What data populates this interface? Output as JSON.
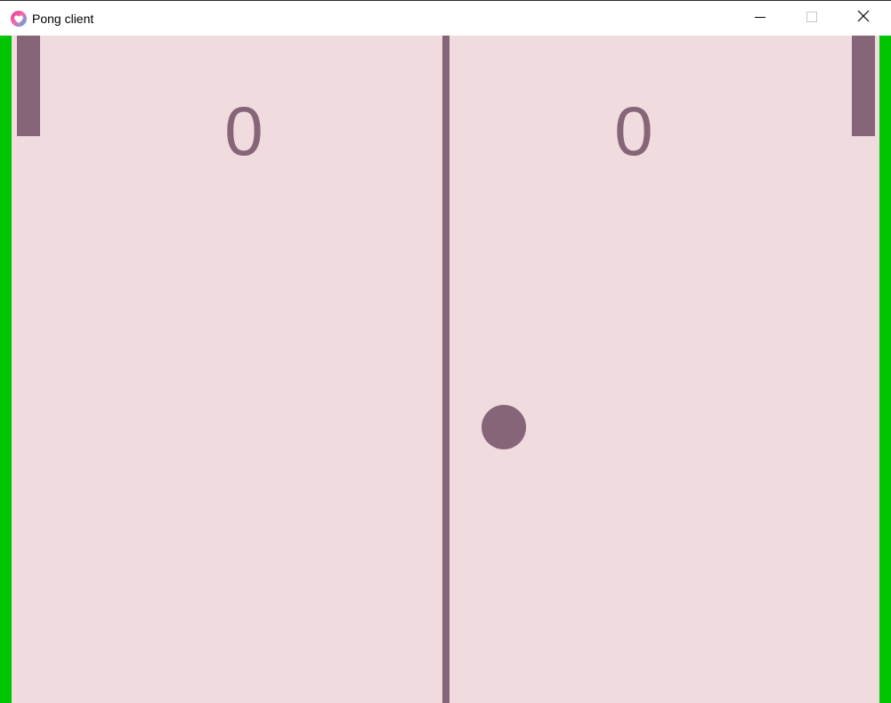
{
  "window": {
    "title": "Pong client",
    "app_icon": "heart-app-icon",
    "controls": {
      "minimize_icon": "minimize-icon",
      "maximize_icon": "maximize-icon",
      "close_icon": "close-icon"
    }
  },
  "game": {
    "scores": {
      "left": "0",
      "right": "0"
    },
    "colors": {
      "background": "#f0dbde",
      "walls": "#00c400",
      "pieces": "#866579"
    }
  }
}
